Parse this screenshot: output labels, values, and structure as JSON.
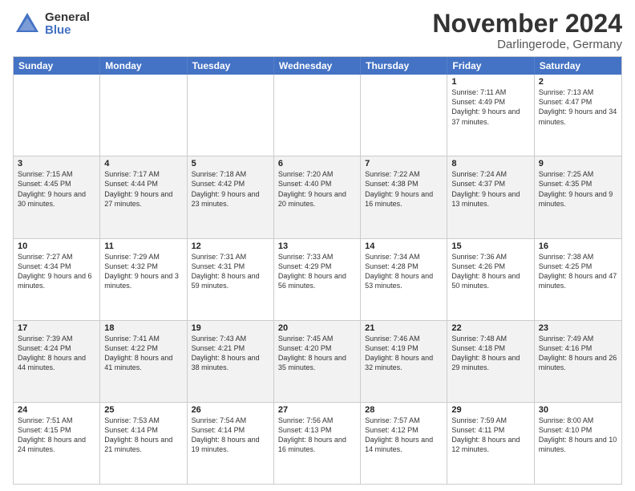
{
  "logo": {
    "general": "General",
    "blue": "Blue"
  },
  "title": "November 2024",
  "location": "Darlingerode, Germany",
  "days": [
    "Sunday",
    "Monday",
    "Tuesday",
    "Wednesday",
    "Thursday",
    "Friday",
    "Saturday"
  ],
  "rows": [
    [
      {
        "day": "",
        "info": ""
      },
      {
        "day": "",
        "info": ""
      },
      {
        "day": "",
        "info": ""
      },
      {
        "day": "",
        "info": ""
      },
      {
        "day": "",
        "info": ""
      },
      {
        "day": "1",
        "info": "Sunrise: 7:11 AM\nSunset: 4:49 PM\nDaylight: 9 hours\nand 37 minutes."
      },
      {
        "day": "2",
        "info": "Sunrise: 7:13 AM\nSunset: 4:47 PM\nDaylight: 9 hours\nand 34 minutes."
      }
    ],
    [
      {
        "day": "3",
        "info": "Sunrise: 7:15 AM\nSunset: 4:45 PM\nDaylight: 9 hours\nand 30 minutes."
      },
      {
        "day": "4",
        "info": "Sunrise: 7:17 AM\nSunset: 4:44 PM\nDaylight: 9 hours\nand 27 minutes."
      },
      {
        "day": "5",
        "info": "Sunrise: 7:18 AM\nSunset: 4:42 PM\nDaylight: 9 hours\nand 23 minutes."
      },
      {
        "day": "6",
        "info": "Sunrise: 7:20 AM\nSunset: 4:40 PM\nDaylight: 9 hours\nand 20 minutes."
      },
      {
        "day": "7",
        "info": "Sunrise: 7:22 AM\nSunset: 4:38 PM\nDaylight: 9 hours\nand 16 minutes."
      },
      {
        "day": "8",
        "info": "Sunrise: 7:24 AM\nSunset: 4:37 PM\nDaylight: 9 hours\nand 13 minutes."
      },
      {
        "day": "9",
        "info": "Sunrise: 7:25 AM\nSunset: 4:35 PM\nDaylight: 9 hours\nand 9 minutes."
      }
    ],
    [
      {
        "day": "10",
        "info": "Sunrise: 7:27 AM\nSunset: 4:34 PM\nDaylight: 9 hours\nand 6 minutes."
      },
      {
        "day": "11",
        "info": "Sunrise: 7:29 AM\nSunset: 4:32 PM\nDaylight: 9 hours\nand 3 minutes."
      },
      {
        "day": "12",
        "info": "Sunrise: 7:31 AM\nSunset: 4:31 PM\nDaylight: 8 hours\nand 59 minutes."
      },
      {
        "day": "13",
        "info": "Sunrise: 7:33 AM\nSunset: 4:29 PM\nDaylight: 8 hours\nand 56 minutes."
      },
      {
        "day": "14",
        "info": "Sunrise: 7:34 AM\nSunset: 4:28 PM\nDaylight: 8 hours\nand 53 minutes."
      },
      {
        "day": "15",
        "info": "Sunrise: 7:36 AM\nSunset: 4:26 PM\nDaylight: 8 hours\nand 50 minutes."
      },
      {
        "day": "16",
        "info": "Sunrise: 7:38 AM\nSunset: 4:25 PM\nDaylight: 8 hours\nand 47 minutes."
      }
    ],
    [
      {
        "day": "17",
        "info": "Sunrise: 7:39 AM\nSunset: 4:24 PM\nDaylight: 8 hours\nand 44 minutes."
      },
      {
        "day": "18",
        "info": "Sunrise: 7:41 AM\nSunset: 4:22 PM\nDaylight: 8 hours\nand 41 minutes."
      },
      {
        "day": "19",
        "info": "Sunrise: 7:43 AM\nSunset: 4:21 PM\nDaylight: 8 hours\nand 38 minutes."
      },
      {
        "day": "20",
        "info": "Sunrise: 7:45 AM\nSunset: 4:20 PM\nDaylight: 8 hours\nand 35 minutes."
      },
      {
        "day": "21",
        "info": "Sunrise: 7:46 AM\nSunset: 4:19 PM\nDaylight: 8 hours\nand 32 minutes."
      },
      {
        "day": "22",
        "info": "Sunrise: 7:48 AM\nSunset: 4:18 PM\nDaylight: 8 hours\nand 29 minutes."
      },
      {
        "day": "23",
        "info": "Sunrise: 7:49 AM\nSunset: 4:16 PM\nDaylight: 8 hours\nand 26 minutes."
      }
    ],
    [
      {
        "day": "24",
        "info": "Sunrise: 7:51 AM\nSunset: 4:15 PM\nDaylight: 8 hours\nand 24 minutes."
      },
      {
        "day": "25",
        "info": "Sunrise: 7:53 AM\nSunset: 4:14 PM\nDaylight: 8 hours\nand 21 minutes."
      },
      {
        "day": "26",
        "info": "Sunrise: 7:54 AM\nSunset: 4:14 PM\nDaylight: 8 hours\nand 19 minutes."
      },
      {
        "day": "27",
        "info": "Sunrise: 7:56 AM\nSunset: 4:13 PM\nDaylight: 8 hours\nand 16 minutes."
      },
      {
        "day": "28",
        "info": "Sunrise: 7:57 AM\nSunset: 4:12 PM\nDaylight: 8 hours\nand 14 minutes."
      },
      {
        "day": "29",
        "info": "Sunrise: 7:59 AM\nSunset: 4:11 PM\nDaylight: 8 hours\nand 12 minutes."
      },
      {
        "day": "30",
        "info": "Sunrise: 8:00 AM\nSunset: 4:10 PM\nDaylight: 8 hours\nand 10 minutes."
      }
    ]
  ]
}
